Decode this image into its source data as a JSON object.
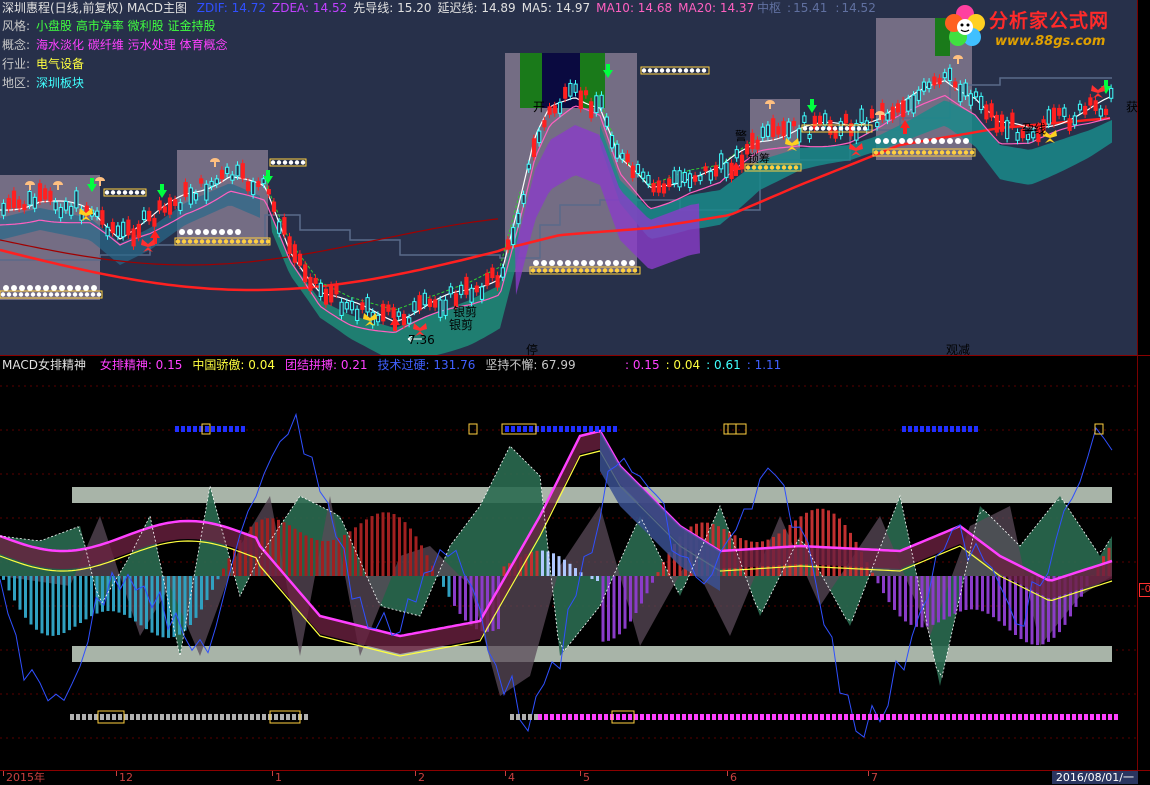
{
  "header": {
    "title": "深圳惠程(日线,前复权) MACD主图",
    "indicators": [
      {
        "label": "ZDIF",
        "value": "14.72",
        "color": "#3050ff"
      },
      {
        "label": "ZDEA",
        "value": "14.52",
        "color": "#c040ff"
      },
      {
        "label": "先导线",
        "value": "15.20",
        "color": "#e0e0e0"
      },
      {
        "label": "延迟线",
        "value": "14.89",
        "color": "#e0e0e0"
      },
      {
        "label": "MA5",
        "value": "14.97",
        "color": "#e0e0e0"
      },
      {
        "label": "MA10",
        "value": "14.68",
        "color": "#ff60c0"
      },
      {
        "label": "MA20",
        "value": "14.37",
        "color": "#ff60c0"
      }
    ],
    "center_label": "中枢",
    "center_value1": "15.41",
    "center_value2": "14.52"
  },
  "stock_info": [
    {
      "key": "风格",
      "value": "小盘股 高市净率 微利股 证金持股",
      "color": "#40ff40"
    },
    {
      "key": "概念",
      "value": "海水淡化 碳纤维 污水处理 体育概念",
      "color": "#ff40ff"
    },
    {
      "key": "行业",
      "value": "电气设备",
      "color": "#ffff40"
    },
    {
      "key": "地区",
      "value": "深圳板块",
      "color": "#40ffff"
    }
  ],
  "logo": {
    "name": "分析家公式网",
    "url": "www.88gs.com"
  },
  "upper_signals": [
    {
      "text": "开",
      "color": "#ffffff"
    },
    {
      "text": "警",
      "color": "#ffffff"
    },
    {
      "text": "锁筹",
      "color": "#ffffff"
    },
    {
      "text": "孕线",
      "color": "#ffffff"
    },
    {
      "text": "获",
      "color": "#00ff40"
    },
    {
      "text": "银剪",
      "color": "#c8c8ff"
    },
    {
      "text": "银剪",
      "color": "#c8c8ff"
    },
    {
      "text": "7.36",
      "color": "#ffffff"
    },
    {
      "text": "停",
      "color": "#00ffff"
    },
    {
      "text": "观减",
      "color": "#ffffff"
    }
  ],
  "lower_header": {
    "title": "MACD女排精神",
    "items": [
      {
        "label": "女排精神",
        "value": "0.15",
        "color": "#ff40ff"
      },
      {
        "label": "中国骄傲",
        "value": "0.04",
        "color": "#ffff40"
      },
      {
        "label": "团结拼搏",
        "value": "0.21",
        "color": "#ff40ff"
      },
      {
        "label": "技术过硬",
        "value": "131.76",
        "color": "#4060ff"
      },
      {
        "label": "坚持不懈",
        "value": "67.99",
        "color": "#c8c8c8"
      }
    ],
    "extra": [
      {
        "value": "0.15",
        "color": "#ff40ff"
      },
      {
        "value": "0.04",
        "color": "#ffff40"
      },
      {
        "value": "0.61",
        "color": "#40ffff"
      },
      {
        "value": "1.11",
        "color": "#4060ff"
      }
    ]
  },
  "y_badge": "-0",
  "x_axis": {
    "labels": [
      "2015年",
      "12",
      "1",
      "2",
      "4",
      "5",
      "6",
      "7"
    ],
    "current_date": "2016/08/01/一"
  },
  "chart_data": {
    "type": "candlestick",
    "title": "深圳惠程(日线,前复权) MACD主图",
    "categories": [
      "2015年",
      "12",
      "1",
      "2",
      "4",
      "5",
      "6",
      "7",
      "2016/08/01/一"
    ],
    "price_low_label": "7.36",
    "lines": [
      {
        "name": "ZDIF",
        "last": 14.72
      },
      {
        "name": "ZDEA",
        "last": 14.52
      },
      {
        "name": "先导线",
        "last": 15.2
      },
      {
        "name": "延迟线",
        "last": 14.89
      },
      {
        "name": "MA5",
        "last": 14.97
      },
      {
        "name": "MA10",
        "last": 14.68
      },
      {
        "name": "MA20",
        "last": 14.37
      }
    ],
    "oscillator_last": [
      {
        "name": "女排精神",
        "value": 0.15
      },
      {
        "name": "中国骄傲",
        "value": 0.04
      },
      {
        "name": "团结拼搏",
        "value": 0.21
      },
      {
        "name": "技术过硬",
        "value": 131.76
      },
      {
        "name": "坚持不懈",
        "value": 67.99
      }
    ]
  },
  "colors": {
    "bg_upper": "#27304a",
    "bg_lower": "#000000",
    "up": "#ff2020",
    "down": "#40ffff",
    "ma_white": "#ffffff",
    "band_green": "#1e8c78",
    "band_purple": "#8a3cc8",
    "ma_red": "#ff2020",
    "box_overlay": "#b4a0b4"
  }
}
